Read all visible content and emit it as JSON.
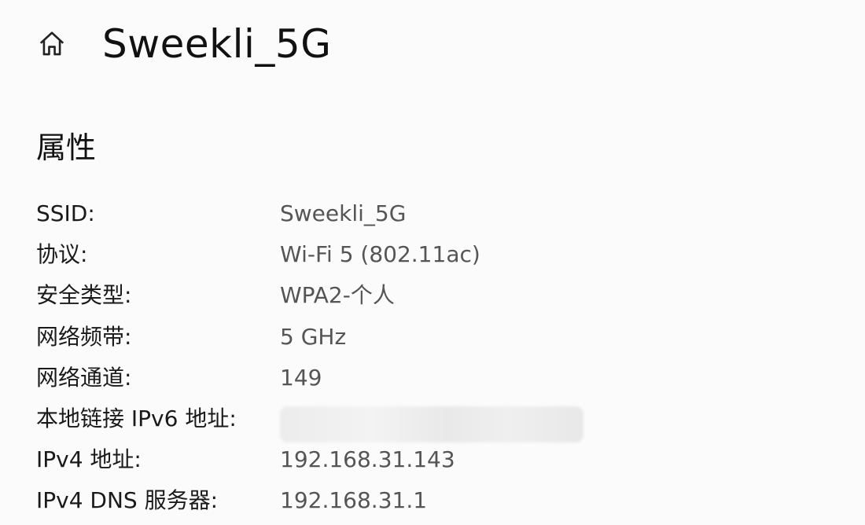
{
  "header": {
    "home_icon": "home-icon",
    "title": "Sweekli_5G"
  },
  "properties": {
    "heading": "属性",
    "rows": [
      {
        "label": "SSID:",
        "value": "Sweekli_5G"
      },
      {
        "label": "协议:",
        "value": "Wi-Fi 5 (802.11ac)"
      },
      {
        "label": "安全类型:",
        "value": "WPA2-个人"
      },
      {
        "label": "网络频带:",
        "value": "5 GHz"
      },
      {
        "label": "网络通道:",
        "value": "149"
      },
      {
        "label": "本地链接 IPv6 地址:",
        "value": null,
        "redacted": true
      },
      {
        "label": "IPv4 地址:",
        "value": "192.168.31.143"
      },
      {
        "label": "IPv4 DNS 服务器:",
        "value": "192.168.31.1"
      }
    ]
  },
  "colors": {
    "background": "#fbfbfb",
    "label_text": "#1a1a1a",
    "value_text": "#555555"
  }
}
